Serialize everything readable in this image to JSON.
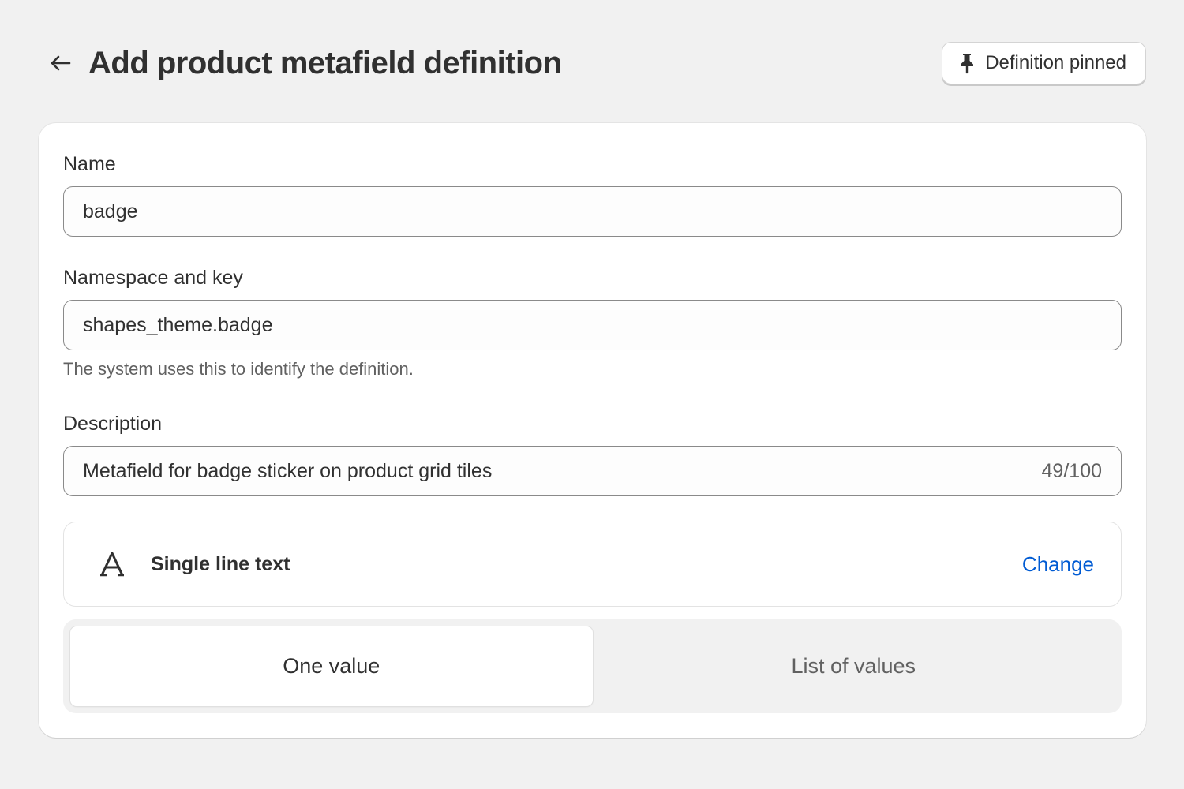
{
  "header": {
    "title": "Add product metafield definition",
    "pin_button_label": "Definition pinned"
  },
  "form": {
    "name": {
      "label": "Name",
      "value": "badge"
    },
    "namespace_key": {
      "label": "Namespace and key",
      "value": "shapes_theme.badge",
      "help": "The system uses this to identify the definition."
    },
    "description": {
      "label": "Description",
      "value": "Metafield for badge sticker on product grid tiles",
      "char_count": "49/100"
    },
    "type": {
      "label": "Single line text",
      "change_label": "Change"
    },
    "value_mode": {
      "options": [
        "One value",
        "List of values"
      ],
      "selected": "One value"
    }
  },
  "icons": {
    "back": "arrow-left-icon",
    "pin": "pin-icon",
    "type": "text-type-icon"
  },
  "colors": {
    "background": "#f1f1f1",
    "link": "#005bd3",
    "text": "#303030",
    "muted": "#616161"
  }
}
